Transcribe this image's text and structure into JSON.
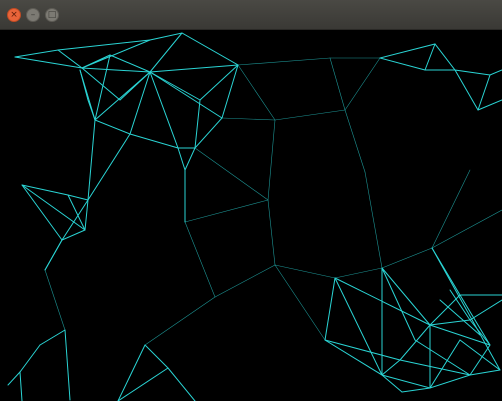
{
  "window": {
    "title": "",
    "controls": {
      "close_glyph": "×",
      "minimize_glyph": "–",
      "maximize_glyph": "□"
    }
  },
  "canvas": {
    "background": "#000000",
    "line_color": "#2ad4d4"
  }
}
